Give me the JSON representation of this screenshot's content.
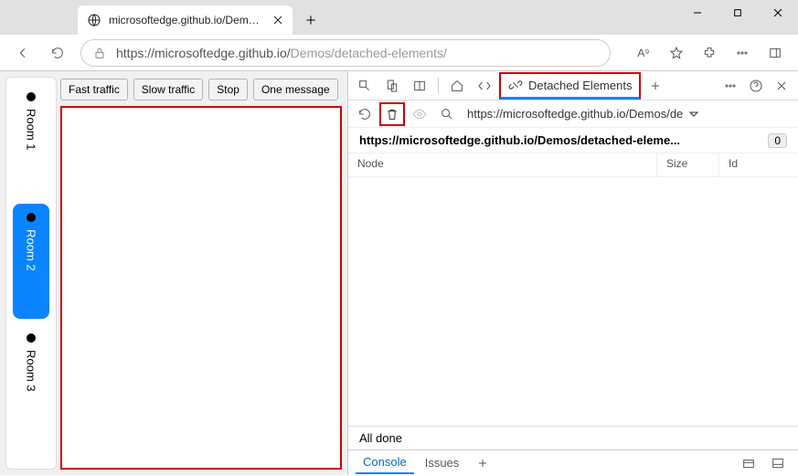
{
  "tab": {
    "title": "microsoftedge.github.io/Demos/d"
  },
  "url_prefix": "https://microsoftedge.github.io/",
  "url_suffix": "Demos/detached-elements/",
  "rooms": [
    "Room 1",
    "Room 2",
    "Room 3"
  ],
  "selected_room": 1,
  "buttons": {
    "fast": "Fast traffic",
    "slow": "Slow traffic",
    "stop": "Stop",
    "one": "One message"
  },
  "devtools": {
    "tab_detached": "Detached Elements",
    "dropdown": "https://microsoftedge.github.io/Demos/de",
    "group_title": "https://microsoftedge.github.io/Demos/detached-eleme...",
    "group_count": "0",
    "cols": {
      "node": "Node",
      "size": "Size",
      "id": "Id"
    },
    "status": "All done",
    "drawer": {
      "console": "Console",
      "issues": "Issues"
    }
  }
}
